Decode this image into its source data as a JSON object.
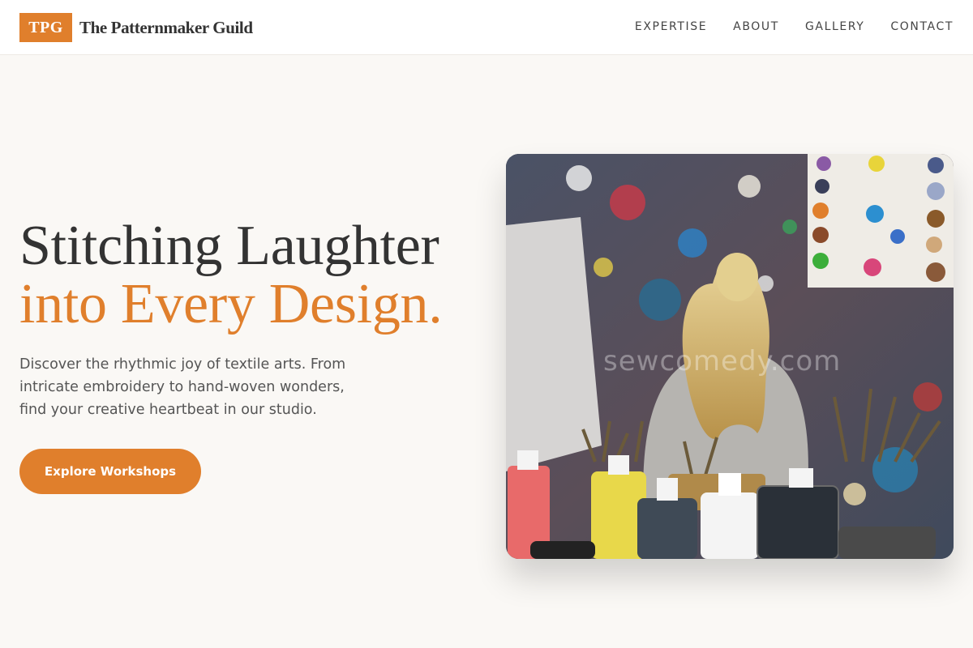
{
  "brand": {
    "logo_text": "TPG",
    "name": "The Patternmaker Guild",
    "accent": "#e07f2c"
  },
  "nav": {
    "items": [
      {
        "label": "EXPERTISE"
      },
      {
        "label": "ABOUT"
      },
      {
        "label": "GALLERY"
      },
      {
        "label": "CONTACT"
      }
    ]
  },
  "hero": {
    "headline_line1": "Stitching Laughter",
    "headline_line2": "into Every Design.",
    "description": "Discover the rhythmic joy of textile arts. From intricate embroidery to hand-woven wonders, find your creative heartbeat in our studio.",
    "cta_label": "Explore Workshops"
  },
  "image": {
    "watermark": "sewcomedy.com"
  },
  "colors": {
    "background": "#faf8f5",
    "heading": "#333333",
    "accent": "#e07f2c",
    "body_text": "#555555"
  }
}
